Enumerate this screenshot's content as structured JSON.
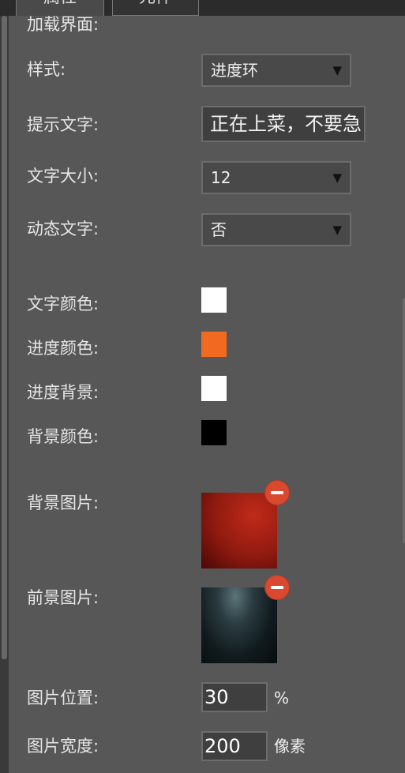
{
  "tabs": [
    {
      "label": "属性"
    },
    {
      "label": "元件"
    }
  ],
  "section_title": "加载界面:",
  "fields": {
    "style": {
      "label": "样式:",
      "value": "进度环"
    },
    "hint_text": {
      "label": "提示文字:",
      "value": "正在上菜，不要急"
    },
    "font_size": {
      "label": "文字大小:",
      "value": "12"
    },
    "dynamic_text": {
      "label": "动态文字:",
      "value": "否"
    },
    "text_color": {
      "label": "文字颜色:",
      "color": "#ffffff"
    },
    "progress_color": {
      "label": "进度颜色:",
      "color": "#f26a22"
    },
    "progress_bg": {
      "label": "进度背景:",
      "color": "#ffffff"
    },
    "bg_color": {
      "label": "背景颜色:",
      "color": "#000000"
    },
    "bg_image": {
      "label": "背景图片:"
    },
    "fg_image": {
      "label": "前景图片:"
    },
    "image_position": {
      "label": "图片位置:",
      "value": "30",
      "unit": "%"
    },
    "image_width": {
      "label": "图片宽度:",
      "value": "200",
      "unit": "像素"
    }
  },
  "icons": {
    "dropdown": "caret-down-icon",
    "remove": "remove-circle-icon"
  }
}
